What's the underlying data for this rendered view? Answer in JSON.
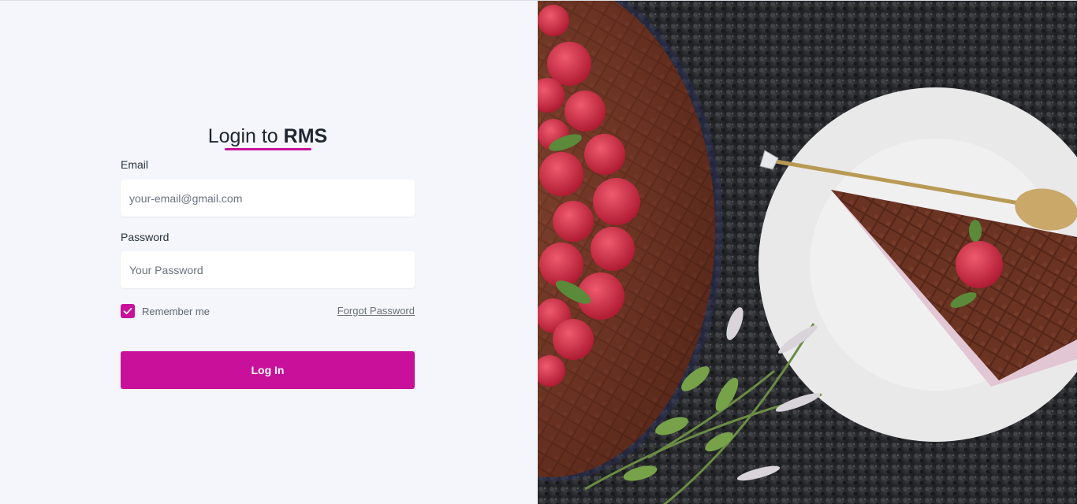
{
  "login": {
    "title_prefix": "Login to ",
    "title_brand": "RMS",
    "email_label": "Email",
    "email_placeholder": "your-email@gmail.com",
    "password_label": "Password",
    "password_placeholder": "Your Password",
    "remember_label": "Remember me",
    "remember_checked": true,
    "forgot_label": "Forgot Password",
    "submit_label": "Log In"
  },
  "colors": {
    "accent": "#c8109b",
    "background": "#f4f6fb"
  },
  "hero_image": {
    "icon": "dessert-photo"
  }
}
